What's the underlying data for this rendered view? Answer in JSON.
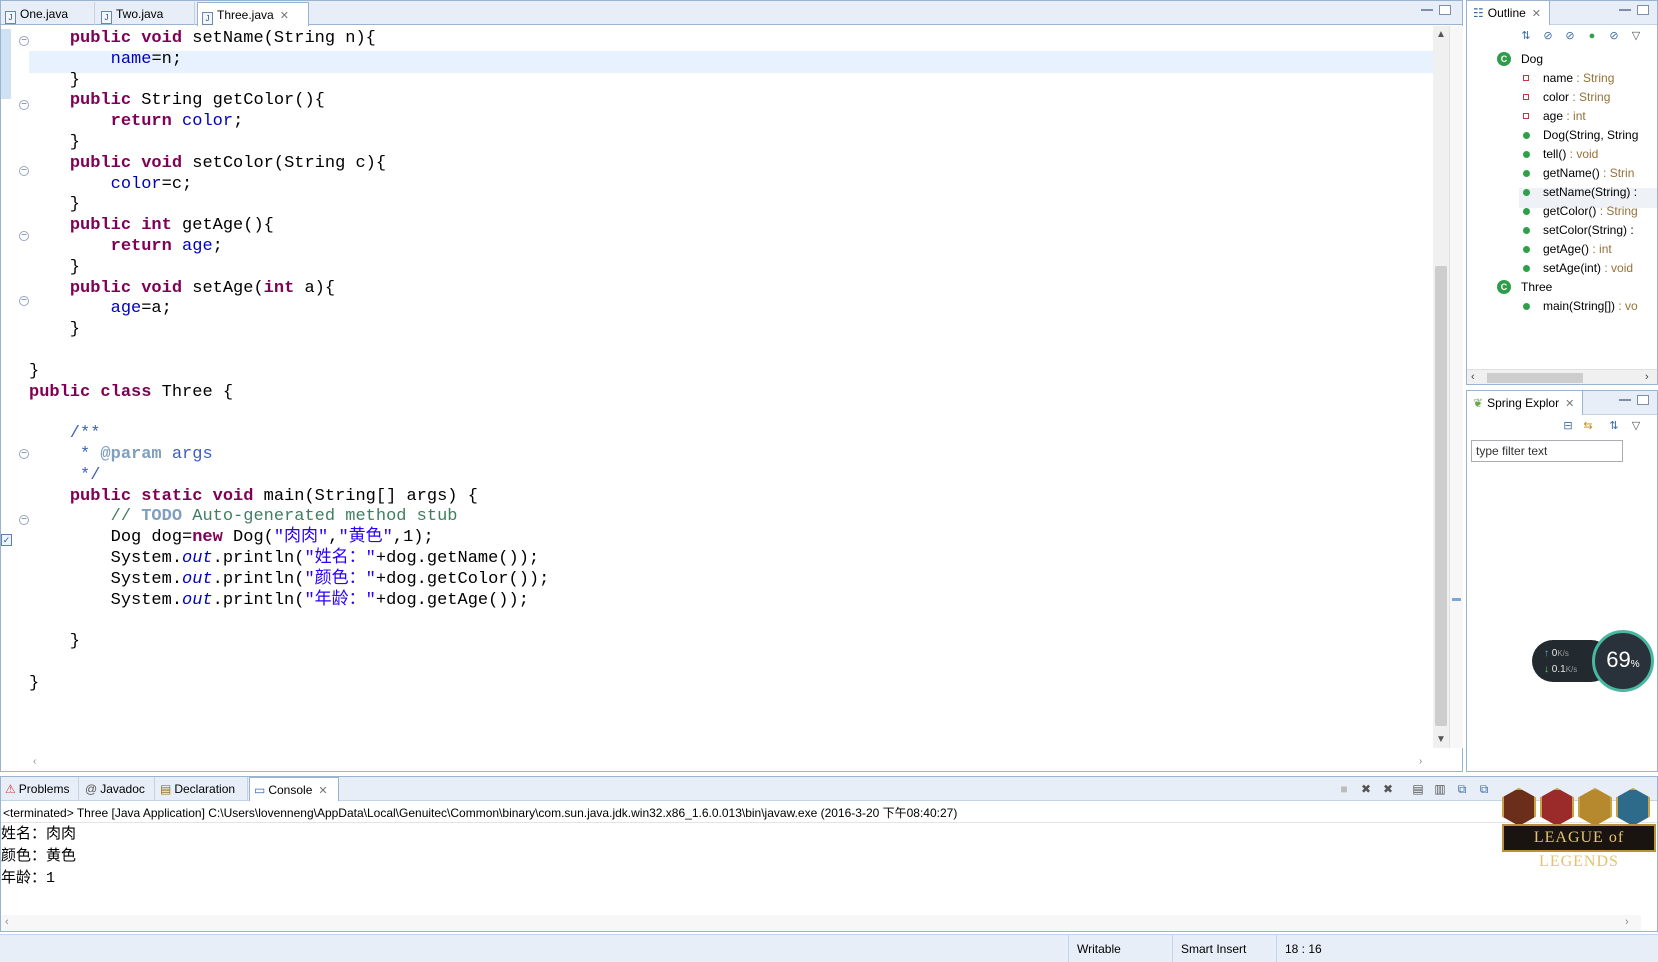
{
  "editor": {
    "tabs": [
      {
        "label": "One.java",
        "active": false
      },
      {
        "label": "Two.java",
        "active": false
      },
      {
        "label": "Three.java",
        "active": true
      }
    ]
  },
  "code_lines": [
    "    public void setName(String n){",
    "        name=n;",
    "    }",
    "    public String getColor(){",
    "        return color;",
    "    }",
    "    public void setColor(String c){",
    "        color=c;",
    "    }",
    "    public int getAge(){",
    "        return age;",
    "    }",
    "    public void setAge(int a){",
    "        age=a;",
    "    }",
    "",
    "}",
    "public class Three {",
    "",
    "    /**",
    "     * @param args",
    "     */",
    "    public static void main(String[] args) {",
    "        // TODO Auto-generated method stub",
    "        Dog dog=new Dog(\"肉肉\",\"黄色\",1);",
    "        System.out.println(\"姓名：\"+dog.getName());",
    "        System.out.println(\"颜色：\"+dog.getColor());",
    "        System.out.println(\"年龄：\"+dog.getAge());",
    "",
    "    }",
    "",
    "}"
  ],
  "outline": {
    "title": "Outline",
    "items": [
      {
        "label": "Dog",
        "type": "",
        "kind": "class",
        "indent": 0
      },
      {
        "label": "name",
        "type": " : String",
        "kind": "private-field",
        "indent": 1
      },
      {
        "label": "color",
        "type": " : String",
        "kind": "private-field",
        "indent": 1
      },
      {
        "label": "age",
        "type": " : int",
        "kind": "private-field",
        "indent": 1
      },
      {
        "label": "Dog(String, String",
        "type": "",
        "kind": "constructor",
        "indent": 1
      },
      {
        "label": "tell()",
        "type": " : void",
        "kind": "method",
        "indent": 1
      },
      {
        "label": "getName()",
        "type": " : Strin",
        "kind": "method",
        "indent": 1
      },
      {
        "label": "setName(String) :",
        "type": "",
        "kind": "method",
        "indent": 1
      },
      {
        "label": "getColor()",
        "type": " : String",
        "kind": "method",
        "indent": 1
      },
      {
        "label": "setColor(String) :",
        "type": "",
        "kind": "method",
        "indent": 1
      },
      {
        "label": "getAge()",
        "type": " : int",
        "kind": "method",
        "indent": 1
      },
      {
        "label": "setAge(int)",
        "type": " : void",
        "kind": "method",
        "indent": 1
      },
      {
        "label": "Three",
        "type": "",
        "kind": "class",
        "indent": 0
      },
      {
        "label": "main(String[])",
        "type": " : vo",
        "kind": "static-method",
        "indent": 1
      }
    ]
  },
  "spring": {
    "title": "Spring Explor",
    "filter_value": "type filter text"
  },
  "network": {
    "up": "0",
    "up_unit": "K/s",
    "down": "0.1",
    "down_unit": "K/s",
    "percent": "69",
    "percent_unit": "%"
  },
  "console": {
    "tabs": [
      {
        "label": "Problems",
        "icon": "problems-icon"
      },
      {
        "label": "Javadoc",
        "icon": "at-icon"
      },
      {
        "label": "Declaration",
        "icon": "declaration-icon"
      },
      {
        "label": "Console",
        "icon": "console-icon"
      }
    ],
    "info": "<terminated> Three [Java Application] C:\\Users\\lovenneng\\AppData\\Local\\Genuitec\\Common\\binary\\com.sun.java.jdk.win32.x86_1.6.0.013\\bin\\javaw.exe (2016-3-20 下午08:40:27)",
    "output": [
      "姓名：肉肉",
      "颜色：黄色",
      "年龄：1"
    ]
  },
  "badge": {
    "text": "LEAGUE of LEGENDS"
  },
  "status": {
    "writable": "Writable",
    "insert_mode": "Smart Insert",
    "position": "18 : 16"
  }
}
